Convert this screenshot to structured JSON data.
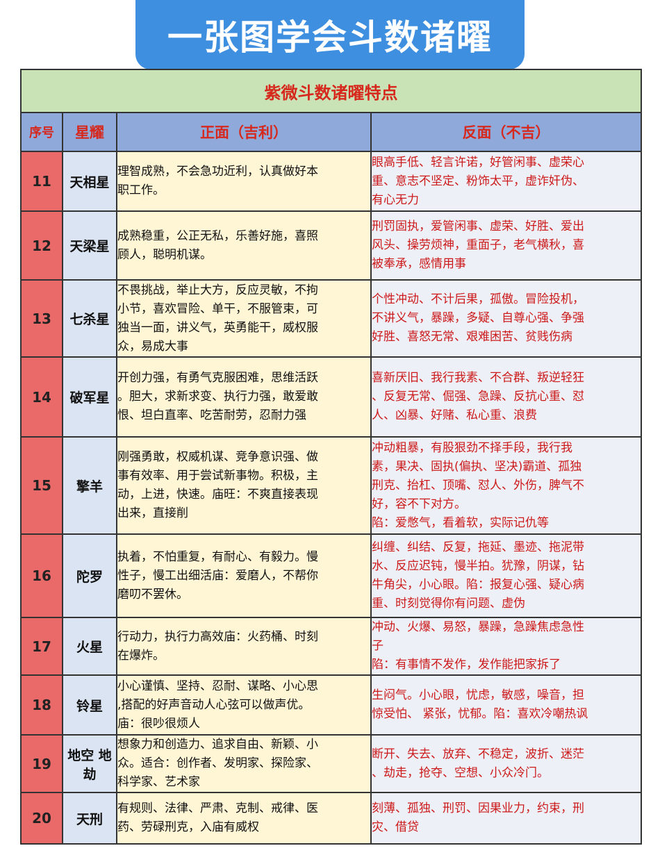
{
  "banner": {
    "title": "一张图学会斗数诸曜"
  },
  "table": {
    "caption": "紫微斗数诸曜特点",
    "headers": {
      "seq": "序号",
      "star": "星耀",
      "positive": "正面（吉利）",
      "negative": "反面（不吉）"
    },
    "rows": [
      {
        "num": "11",
        "star": "天相星",
        "pos": [
          "理智成熟，不会急功近利，认真做好本",
          "职工作。"
        ],
        "neg": [
          "眼高手低、轻言许诺，好管闲事、虚荣心",
          "重、意志不坚定、粉饰太平，虚诈奸伪、",
          "有心无力"
        ]
      },
      {
        "num": "12",
        "star": "天梁星",
        "pos": [
          "成熟稳重，公正无私，乐善好施，喜照",
          "顾人，聪明机谋。"
        ],
        "neg": [
          "刑罚固执，爱管闲事、虚荣、好胜、爱出",
          "风头、操劳烦神，重面子，老气横秋，喜",
          "被奉承，感情用事"
        ]
      },
      {
        "num": "13",
        "star": "七杀星",
        "pos": [
          "不畏挑战，举止大方，反应灵敏，不拘",
          "小节，喜欢冒险、单干，不服管束，可",
          "独当一面，讲义气，英勇能干，威权服",
          "众，易成大事"
        ],
        "neg": [
          "个性冲动、不计后果，孤傲。冒险投机，",
          "不讲义气，暴躁，多疑、自尊心强、争强",
          "好胜、喜怒无常、艰难困苦、贫贱伤病"
        ]
      },
      {
        "num": "14",
        "star": "破军星",
        "pos": [
          "开创力强，有勇气克服困难，思维活跃",
          "。胆大，求新求变、执行力强，敢爱敢",
          "恨、坦白直率、吃苦耐劳，忍耐力强"
        ],
        "neg": [
          "喜新厌旧、我行我素、不合群、叛逆轻狂",
          "、反复无常、倔强、急躁、反抗心重、怼",
          "人、凶暴、好赌、私心重、浪费"
        ]
      },
      {
        "num": "15",
        "star": "擎羊",
        "pos": [
          "刚强勇敢，权威机谋、竞争意识强、做",
          "事有效率、用于尝试新事物。积极，主",
          "动，上进，快速。庙旺：不爽直接表现",
          "出来，直接削"
        ],
        "neg": [
          "冲动粗暴，有股狠劲不择手段，我行我",
          "素，果决、固执(偏执、坚决)霸道、孤独",
          "刑克、抬杠、顶嘴、怼人、外伤，脾气不",
          "好，容不下对方。",
          "陷：爱憋气，看着软，实际记仇等"
        ]
      },
      {
        "num": "16",
        "star": "陀罗",
        "pos": [
          "执着，不怕重复，有耐心、有毅力。慢",
          "性子，慢工出细活庙：爱磨人，不帮你",
          "磨叨不罢休。"
        ],
        "neg": [
          "纠缠、纠结、反复，拖延、墨迹、拖泥带",
          "水、反应迟钝，慢半拍。犹豫，阴谋，钻",
          "牛角尖，小心眼。陷：报复心强、疑心病",
          "重、时刻觉得你有问题、虚伪"
        ]
      },
      {
        "num": "17",
        "star": "火星",
        "pos": [
          "行动力，执行力高效庙：火药桶、时刻",
          "在爆炸。"
        ],
        "neg": [
          "冲动、火爆、易怒，暴躁，急躁焦虑急性",
          "子",
          "陷：有事情不发作，发作能把家拆了"
        ]
      },
      {
        "num": "18",
        "star": "铃星",
        "pos": [
          "小心谨慎、坚持、忍耐、谋略、小心思",
          ",搭配的好声音动人心弦可以做声优。",
          "庙：很吵很烦人"
        ],
        "neg": [
          "生闷气。小心眼，忧虑，敏感，噪音，担",
          "惊受怕、 紧张，忧郁。陷：喜欢冷嘲热讽"
        ]
      },
      {
        "num": "19",
        "star": "地空 地劫",
        "pos": [
          "想象力和创造力、追求自由、新颖、小",
          "众。适合：创作者、发明家、探险家、",
          "科学家、艺术家"
        ],
        "neg": [
          "断开、失去、放弃、不稳定，波折、迷茫",
          "、劫走，抢夺、空想、小众冷门。"
        ]
      },
      {
        "num": "20",
        "star": "天刑",
        "pos": [
          "有规则、法律、严肃、克制、戒律、医",
          "药、劳碌刑克，入庙有威权"
        ],
        "neg": [
          "刻薄、孤独、刑罚、因果业力，约束，刑",
          "灾、借贷"
        ]
      }
    ]
  }
}
